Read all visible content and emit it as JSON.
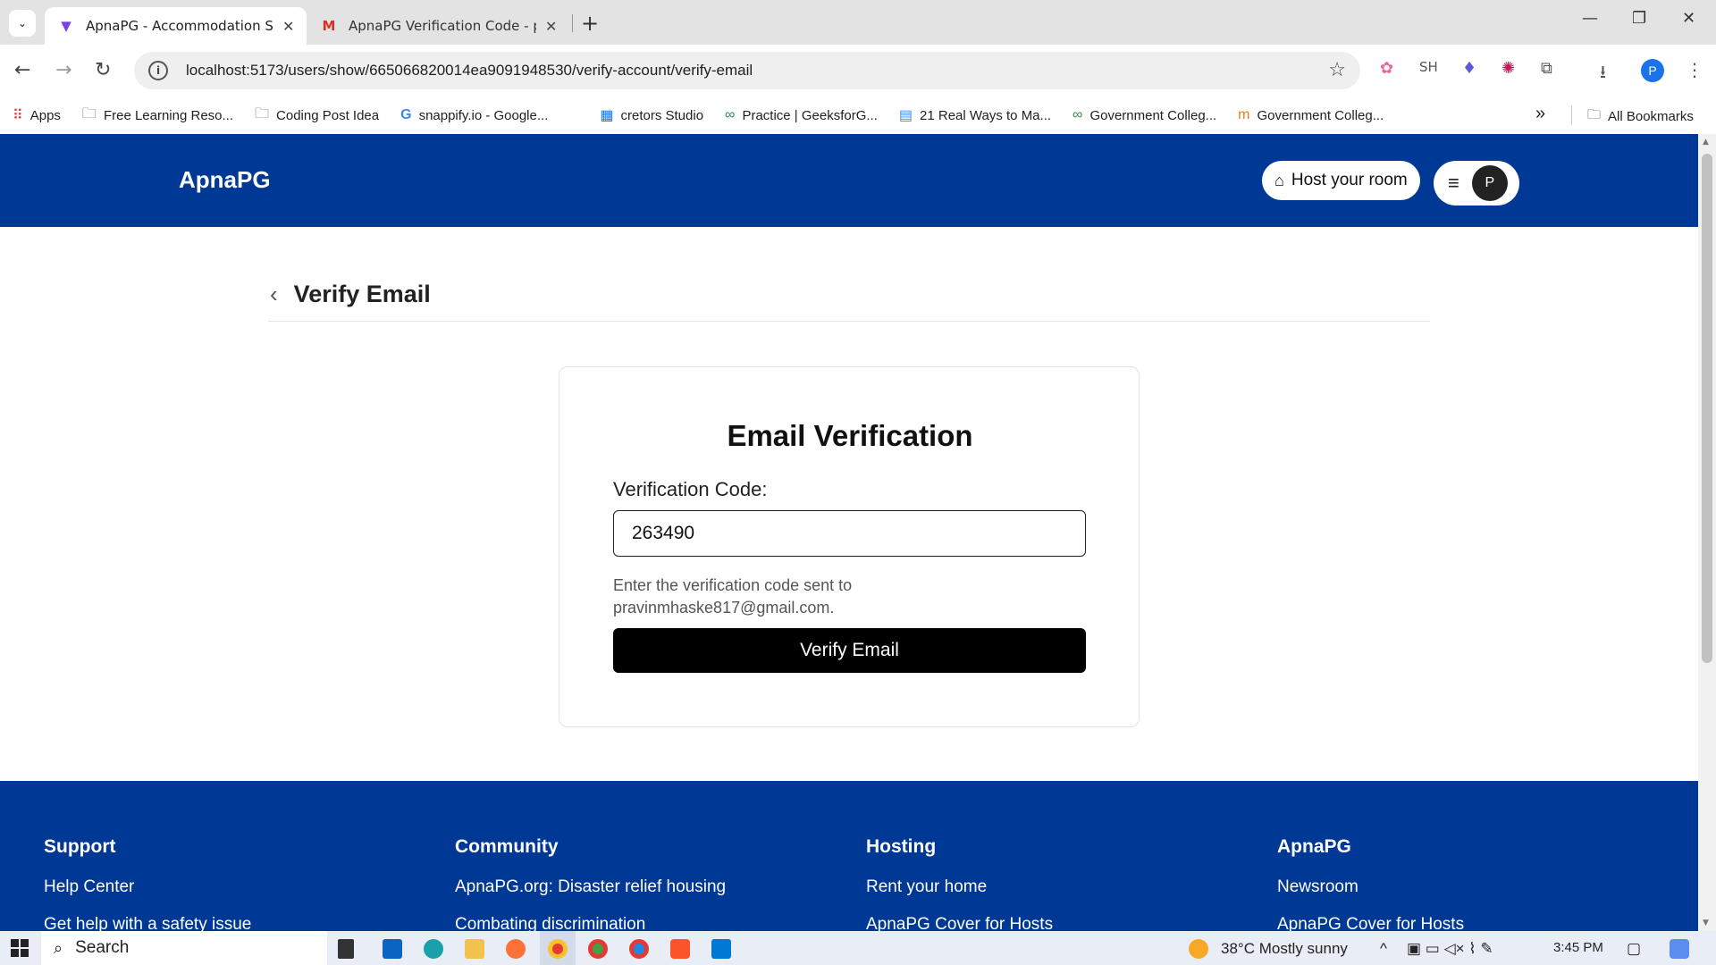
{
  "browser": {
    "tabs": [
      {
        "title": "ApnaPG - Accommodation Solu",
        "favicon": "apnapg-logo-icon",
        "active": true
      },
      {
        "title": "ApnaPG Verification Code - pra",
        "favicon": "gmail-icon",
        "active": false
      }
    ],
    "url": "localhost:5173/users/show/665066820014ea9091948530/verify-account/verify-email",
    "profile_initial": "P",
    "extensions": [
      "bookmark-star-icon",
      "sh-extension",
      "ext-flame-icon",
      "ext-color-wheel-icon",
      "puzzle-icon",
      "download-icon"
    ],
    "sh_label": "SH",
    "bookmarks": [
      {
        "label": "Apps",
        "icon": "apps-grid-icon"
      },
      {
        "label": "Free Learning Reso...",
        "icon": "folder-icon"
      },
      {
        "label": "Coding Post Idea",
        "icon": "folder-icon"
      },
      {
        "label": "snappify.io - Google...",
        "icon": "google-icon"
      },
      {
        "label": "cretors Studio",
        "icon": "studio-icon"
      },
      {
        "label": "Practice | GeeksforG...",
        "icon": "gfg-icon"
      },
      {
        "label": "21 Real Ways to Ma...",
        "icon": "docs-icon"
      },
      {
        "label": "Government Colleg...",
        "icon": "gfg-icon"
      },
      {
        "label": "Government Colleg...",
        "icon": "site-icon"
      }
    ],
    "all_bookmarks": "All Bookmarks"
  },
  "site": {
    "logo": "ApnaPG",
    "host_button": "Host your room",
    "avatar_initial": "P",
    "page_title": "Verify Email",
    "card": {
      "heading": "Email Verification",
      "label": "Verification Code:",
      "code_value": "263490",
      "hint_line1": "Enter the verification code sent to",
      "hint_line2": "pravinmhaske817@gmail.com.",
      "button": "Verify Email"
    },
    "footer": [
      {
        "heading": "Support",
        "links": [
          "Help Center",
          "Get help with a safety issue"
        ]
      },
      {
        "heading": "Community",
        "links": [
          "ApnaPG.org: Disaster relief housing",
          "Combating discrimination"
        ]
      },
      {
        "heading": "Hosting",
        "links": [
          "Rent your home",
          "ApnaPG Cover for Hosts"
        ]
      },
      {
        "heading": "ApnaPG",
        "links": [
          "Newsroom",
          "ApnaPG Cover for Hosts"
        ]
      }
    ],
    "colors": {
      "brand_blue": "#003896",
      "button": "#000000"
    }
  },
  "taskbar": {
    "search": "Search",
    "weather": "38°C  Mostly sunny",
    "time": "3:45 PM"
  }
}
